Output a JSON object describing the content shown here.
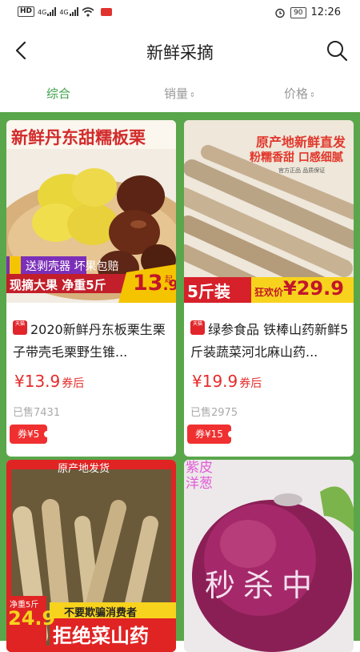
{
  "status_bar": {
    "hd_label": "HD",
    "signal_1": "4G",
    "signal_2": "4G",
    "battery": "90",
    "time": "12:26"
  },
  "header": {
    "title": "新鲜采摘",
    "back_icon": "back-arrow-icon",
    "search_icon": "search-icon"
  },
  "tabs": [
    {
      "label": "综合",
      "active": true
    },
    {
      "label": "销量",
      "sort": "⇕"
    },
    {
      "label": "价格",
      "sort": "⇕"
    }
  ],
  "colors": {
    "accent_green": "#3ca04a",
    "grid_bg": "#5aa64a",
    "price_red": "#e52b2b"
  },
  "products": [
    {
      "image": {
        "banner": "新鲜丹东甜糯板栗",
        "promo_1": "送剥壳器",
        "promo_2": "坏果包赔",
        "ribbon_1": "现摘大果",
        "ribbon_2": "净重5斤",
        "price_big": "13",
        "price_small": ".9",
        "price_qi": "起"
      },
      "shop_badge": "天猫",
      "title": "2020新鲜丹东板栗生栗子带壳毛栗野生锥...",
      "price": "¥13.9",
      "price_suffix": "券后",
      "sold": "已售7431",
      "coupon": "券¥5"
    },
    {
      "image": {
        "banner_1": "原产地新鲜直发",
        "banner_2": "粉糯香甜 口感细腻",
        "banner_3": "官方正品 品质保证",
        "weight": "5斤装",
        "sale_label": "狂欢价",
        "price_big": "¥29.9"
      },
      "shop_badge": "天猫",
      "title": "绿参食品 铁棒山药新鲜5斤装蔬菜河北麻山药...",
      "price": "¥19.9",
      "price_suffix": "券后",
      "sold": "已售2975",
      "coupon": "券¥15"
    },
    {
      "image": {
        "banner": "原产地发货",
        "weight": "净重5斤",
        "price_big": "24.9",
        "slogan_1": "不要欺骗消费者",
        "slogan_2": "拒绝菜山药"
      }
    },
    {
      "image": {
        "tag_1": "紫皮",
        "tag_2": "洋葱",
        "overlay": "秒杀中"
      }
    }
  ]
}
